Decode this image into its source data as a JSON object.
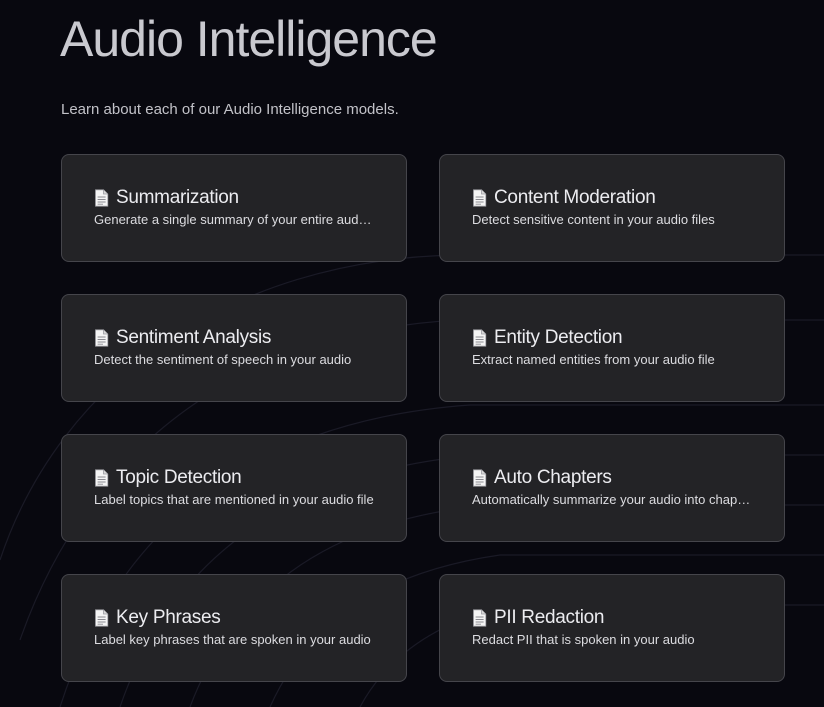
{
  "header": {
    "title": "Audio Intelligence",
    "subtitle": "Learn about each of our Audio Intelligence models."
  },
  "colors": {
    "background": "#08080f",
    "card": "#232326",
    "card_border": "#45454b"
  },
  "cards": [
    {
      "icon": "document-icon",
      "title": "Summarization",
      "description": "Generate a single summary of your entire audio ..."
    },
    {
      "icon": "document-icon",
      "title": "Content Moderation",
      "description": "Detect sensitive content in your audio files"
    },
    {
      "icon": "document-icon",
      "title": "Sentiment Analysis",
      "description": "Detect the sentiment of speech in your audio"
    },
    {
      "icon": "document-icon",
      "title": "Entity Detection",
      "description": "Extract named entities from your audio file"
    },
    {
      "icon": "document-icon",
      "title": "Topic Detection",
      "description": "Label topics that are mentioned in your audio file"
    },
    {
      "icon": "document-icon",
      "title": "Auto Chapters",
      "description": "Automatically summarize your audio into chapte..."
    },
    {
      "icon": "document-icon",
      "title": "Key Phrases",
      "description": "Label key phrases that are spoken in your audio"
    },
    {
      "icon": "document-icon",
      "title": "PII Redaction",
      "description": "Redact PII that is spoken in your audio"
    }
  ]
}
